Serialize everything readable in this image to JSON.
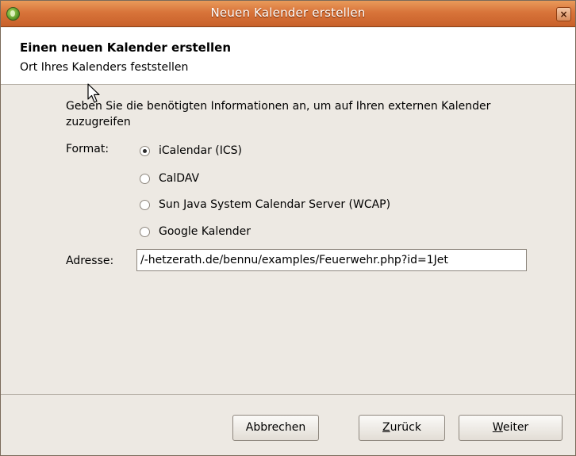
{
  "window": {
    "title": "Neuen Kalender erstellen",
    "close_label": "×"
  },
  "header": {
    "title": "Einen neuen Kalender erstellen",
    "subtitle": "Ort Ihres Kalenders feststellen"
  },
  "content": {
    "description": "Geben Sie die benötigten Informationen an, um auf Ihren externen Kalender zuzugreifen",
    "format_label": "Format:",
    "format_options": [
      {
        "label": "iCalendar (ICS)",
        "selected": true
      },
      {
        "label": "CalDAV",
        "selected": false
      },
      {
        "label": "Sun Java System Calendar Server (WCAP)",
        "selected": false
      },
      {
        "label": "Google Kalender",
        "selected": false
      }
    ],
    "address_label": "Adresse:",
    "address_value": "/-hetzerath.de/bennu/examples/Feuerwehr.php?id=1Jet"
  },
  "buttons": {
    "cancel": "Abbrechen",
    "back_mnemonic": "Z",
    "back_rest": "urück",
    "next_mnemonic": "W",
    "next_rest": "eiter"
  },
  "colors": {
    "titlebar": "#d8743a",
    "dialog_bg": "#ede9e3"
  }
}
